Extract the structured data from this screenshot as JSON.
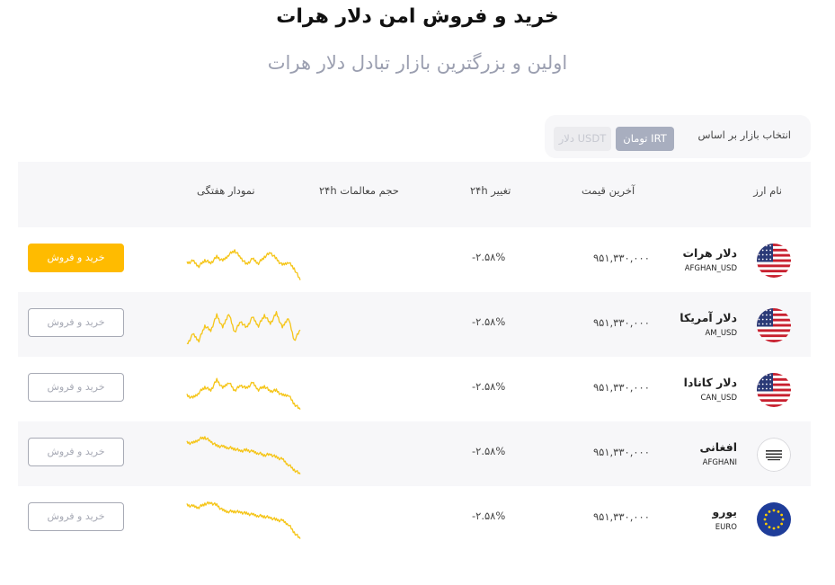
{
  "page": {
    "title": "خرید و فروش امن دلار هرات",
    "subtitle": "اولین و بزرگترین بازار تبادل دلار هرات"
  },
  "filter": {
    "label": "انتخاب بازار بر اساس",
    "options": [
      "تومان IRT",
      "دلار USDT"
    ],
    "selected": "تومان IRT"
  },
  "table": {
    "headers": {
      "name": "نام ارز",
      "price": "آخرین قیمت",
      "change": "تغییر ۲۴h",
      "volume": "حجم معالمات ۲۴h",
      "chart": "نمودار هفتگی"
    },
    "rows": [
      {
        "name": "دلار هرات",
        "code": "AFGHAN_USD",
        "flag": "us-flag-icon",
        "price": "۹۵۱,۳۳۰,۰۰۰",
        "change": "-۲.۵۸%",
        "button": "خرید و فروش",
        "button_style": "primary",
        "trend": [
          0.55,
          0.5,
          0.62,
          0.48,
          0.55,
          0.4,
          0.5,
          0.35,
          0.25,
          0.42,
          0.58,
          0.45,
          0.55,
          0.4,
          0.3,
          0.45,
          0.6,
          0.52,
          0.68,
          0.95
        ]
      },
      {
        "name": "دلار آمریکا",
        "code": "AM_USD",
        "flag": "us-flag-icon",
        "price": "۹۵۱,۳۳۰,۰۰۰",
        "change": "-۲.۵۸%",
        "button": "خرید و فروش",
        "button_style": "outline",
        "trend": [
          0.95,
          0.7,
          0.85,
          0.5,
          0.62,
          0.25,
          0.55,
          0.2,
          0.65,
          0.4,
          0.55,
          0.3,
          0.5,
          0.25,
          0.45,
          0.2,
          0.55,
          0.3,
          0.85,
          0.6
        ]
      },
      {
        "name": "دلار کانادا",
        "code": "CAN_USD",
        "flag": "us-flag-icon",
        "price": "۹۵۱,۳۳۰,۰۰۰",
        "change": "-۲.۵۸%",
        "button": "خرید و فروش",
        "button_style": "outline",
        "trend": [
          0.62,
          0.68,
          0.55,
          0.42,
          0.5,
          0.25,
          0.45,
          0.3,
          0.5,
          0.38,
          0.45,
          0.32,
          0.48,
          0.4,
          0.52,
          0.5,
          0.62,
          0.6,
          0.82,
          0.95
        ]
      },
      {
        "name": "افغانی",
        "code": "AFGHANI",
        "flag": "afghan-flag-icon",
        "price": "۹۵۱,۳۳۰,۰۰۰",
        "change": "-۲.۵۸%",
        "button": "خرید و فروش",
        "button_style": "outline",
        "trend": [
          0.2,
          0.22,
          0.12,
          0.08,
          0.18,
          0.28,
          0.3,
          0.32,
          0.35,
          0.4,
          0.38,
          0.42,
          0.45,
          0.5,
          0.48,
          0.55,
          0.6,
          0.72,
          0.85,
          0.95
        ]
      },
      {
        "name": "یورو",
        "code": "EURO",
        "flag": "eu-flag-icon",
        "price": "۹۵۱,۳۳۰,۰۰۰",
        "change": "-۲.۵۸%",
        "button": "خرید و فروش",
        "button_style": "outline",
        "trend": [
          0.15,
          0.18,
          0.2,
          0.12,
          0.1,
          0.15,
          0.28,
          0.3,
          0.3,
          0.32,
          0.35,
          0.38,
          0.4,
          0.42,
          0.45,
          0.5,
          0.52,
          0.6,
          0.8,
          0.95
        ]
      }
    ]
  },
  "colors": {
    "accent": "#ffbb00",
    "sparkline": "#f5c518",
    "muted": "#a7aab5"
  }
}
